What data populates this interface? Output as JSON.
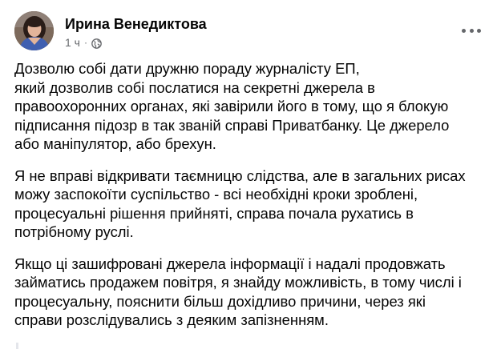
{
  "post": {
    "author": "Ирина Венедиктова",
    "time": "1 ч",
    "separator": "·",
    "icons": {
      "avatar": "profile-photo",
      "privacy": "globe-icon",
      "menu": "more-horizontal-icon"
    },
    "paragraphs": [
      "Дозволю собі дати дружню пораду журналісту ЕП,\nякий дозволив собі послатися на секретні джерела в\nправоохоронних органах, які завірили його в тому, що я блокую\nпідписання підозр в так званій справі Приватбанку. Це джерело\nабо маніпулятор, або брехун.",
      "Я не вправі відкривати таємницю слідства, але в загальних рисах\nможу заспокоїти суспільство - всі необхідні кроки зроблені,\nпроцесуальні рішення прийняті, справа почала рухатись в\nпотрібному руслі.",
      "Якщо ці зашифровані джерела інформації і надалі продовжать\nзайматись продажем повітря, я знайду можливість, в тому числі і\nпроцесуальну, пояснити більш дохідливо причини, через які\nсправи розслідувались з деяким запізненням."
    ]
  }
}
